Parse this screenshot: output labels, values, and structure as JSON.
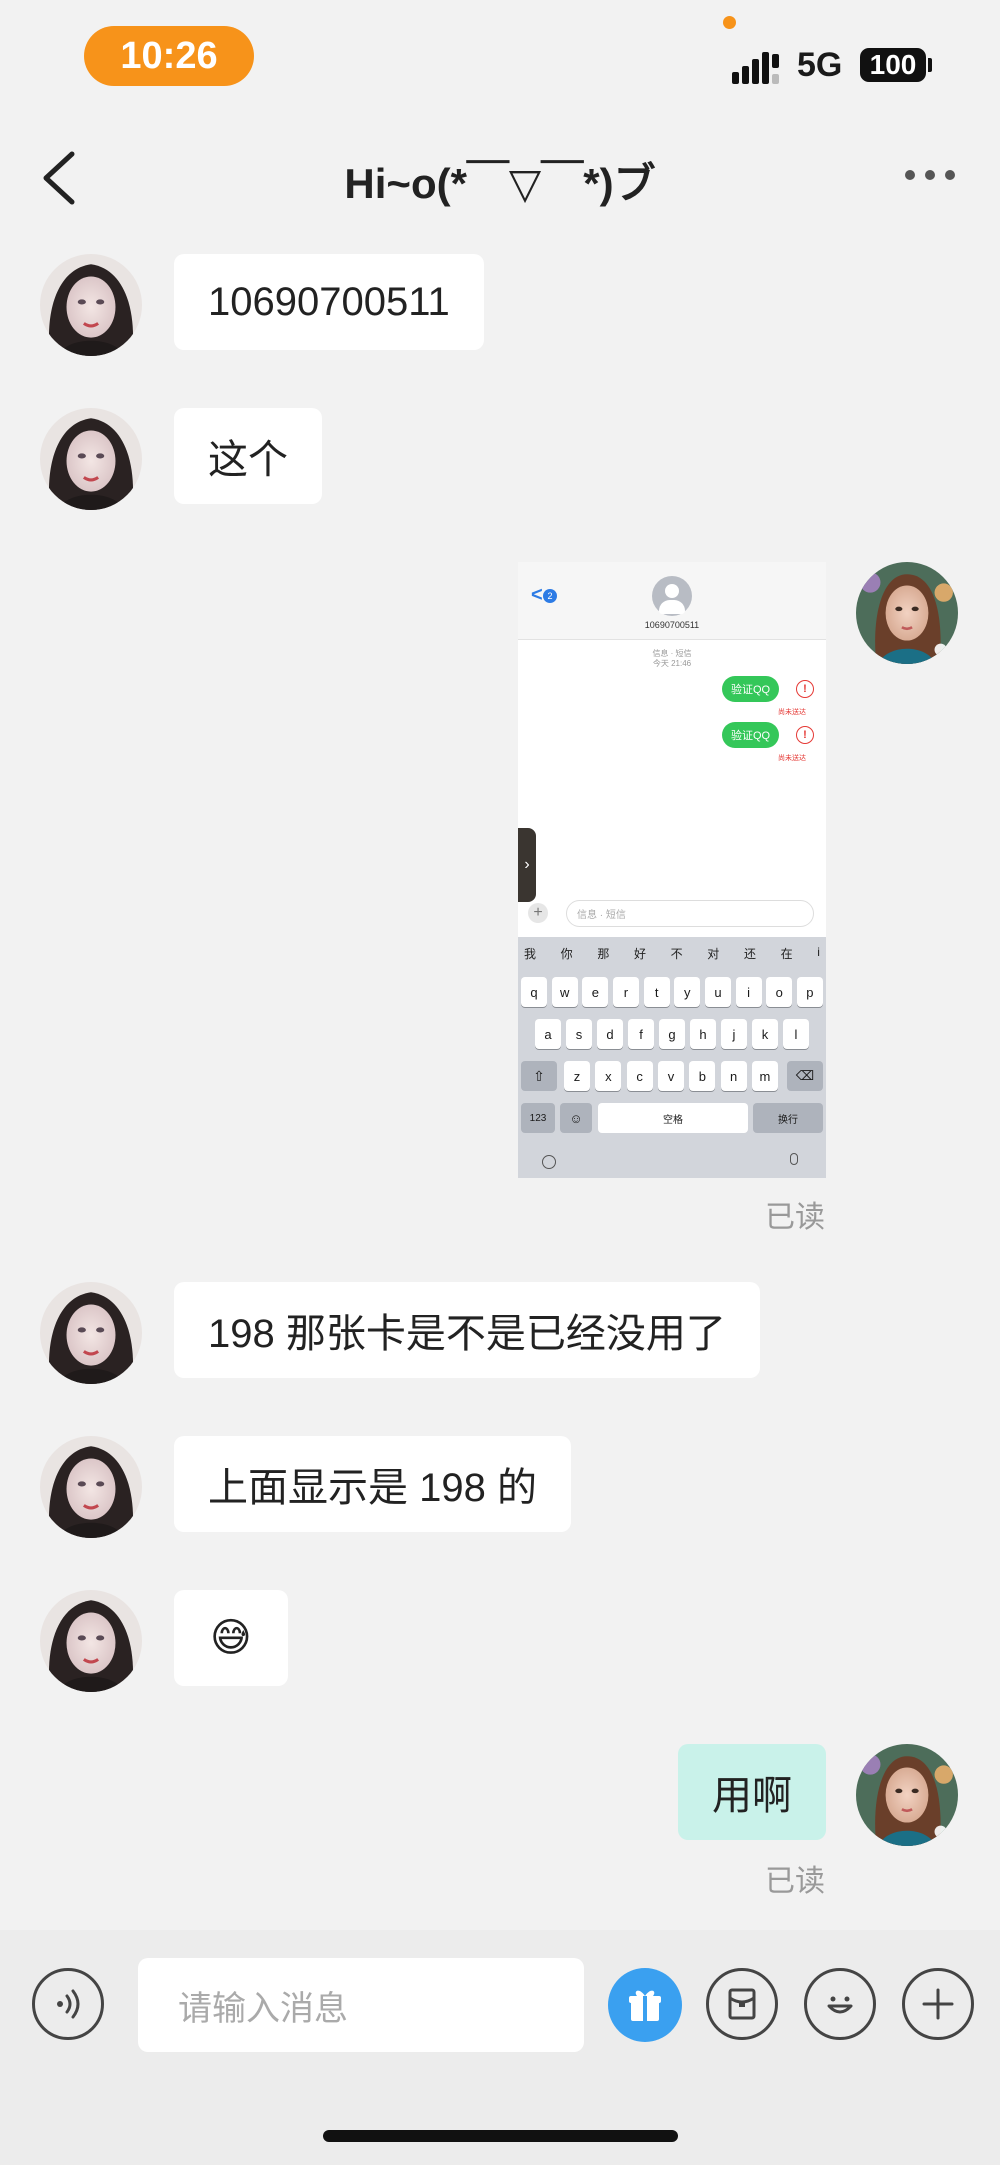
{
  "status_bar": {
    "time": "10:26",
    "network": "5G",
    "battery": "100"
  },
  "header": {
    "title": "Hi~o(*￣▽￣*)ブ"
  },
  "messages": [
    {
      "side": "left",
      "text": "10690700511"
    },
    {
      "side": "left",
      "text": "这个"
    },
    {
      "side": "right",
      "type": "image",
      "read_label": "已读"
    },
    {
      "side": "left",
      "text": "198 那张卡是不是已经没用了"
    },
    {
      "side": "left",
      "text": "上面显示是 198 的"
    },
    {
      "side": "left",
      "text": "😅"
    },
    {
      "side": "right",
      "text": "用啊",
      "read_label": "已读"
    }
  ],
  "screenshot": {
    "contact": "10690700511",
    "back_badge": "2",
    "meta_line1": "信息 · 短信",
    "meta_line2": "今天 21:46",
    "sent_messages": [
      "验证QQ",
      "验证QQ"
    ],
    "failed_label": "尚未送达",
    "input_placeholder": "信息 · 短信",
    "candidates": [
      "我",
      "你",
      "那",
      "好",
      "不",
      "对",
      "还",
      "在",
      "i"
    ],
    "row1": [
      "q",
      "w",
      "e",
      "r",
      "t",
      "y",
      "u",
      "i",
      "o",
      "p"
    ],
    "row2": [
      "a",
      "s",
      "d",
      "f",
      "g",
      "h",
      "j",
      "k",
      "l"
    ],
    "row3": [
      "z",
      "x",
      "c",
      "v",
      "b",
      "n",
      "m"
    ],
    "key_123": "123",
    "key_space": "空格",
    "key_return": "换行"
  },
  "composer": {
    "placeholder": "请输入消息"
  },
  "icons": [
    "back-icon",
    "more-icon",
    "voice-icon",
    "gift-icon",
    "red-packet-icon",
    "emoji-icon",
    "plus-icon"
  ],
  "colors": {
    "accent": "#f7931a",
    "mine_bubble": "#c9f2ea",
    "gift": "#3aa0f0",
    "imessage_green": "#34c759"
  }
}
